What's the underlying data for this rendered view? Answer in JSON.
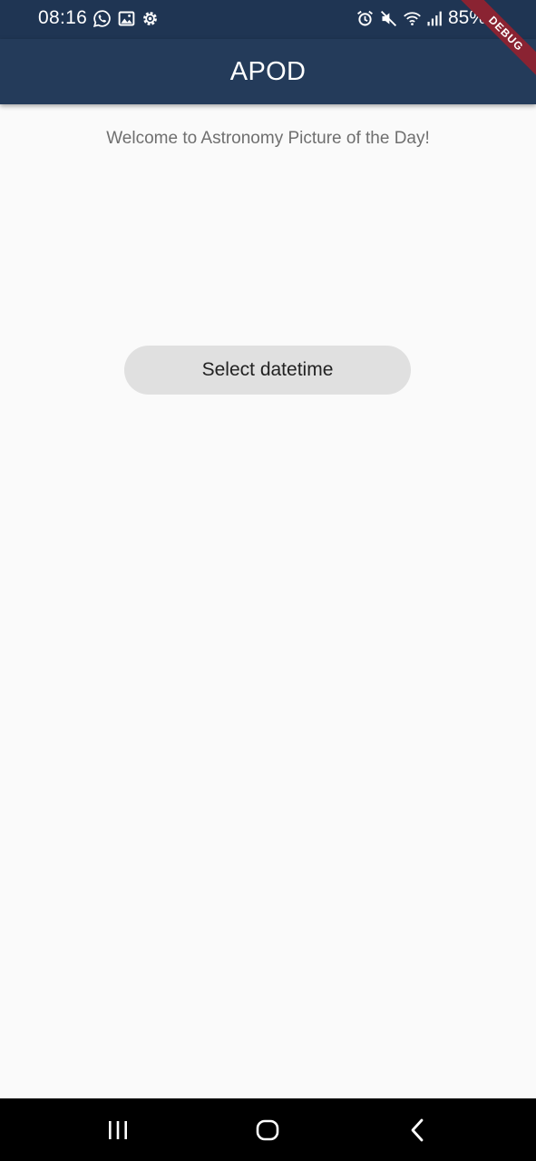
{
  "status_bar": {
    "time": "08:16",
    "battery_percent": "85%",
    "icons": [
      "whatsapp-icon",
      "gallery-icon",
      "settings-icon",
      "alarm-icon",
      "mute-icon",
      "wifi-icon",
      "signal-icon",
      "battery-charging-icon"
    ]
  },
  "app_bar": {
    "title": "APOD"
  },
  "debug_banner": {
    "label": "DEBUG"
  },
  "main": {
    "welcome_text": "Welcome to Astronomy Picture of the Day!",
    "select_button_label": "Select datetime"
  },
  "nav_bar": {
    "buttons": [
      "recents",
      "home",
      "back"
    ]
  },
  "colors": {
    "status_bar_bg": "#1f3553",
    "app_bar_bg": "#243b5a",
    "page_bg": "#fafafa",
    "button_bg": "#e0e0e0",
    "debug_ribbon": "#8a2332"
  }
}
